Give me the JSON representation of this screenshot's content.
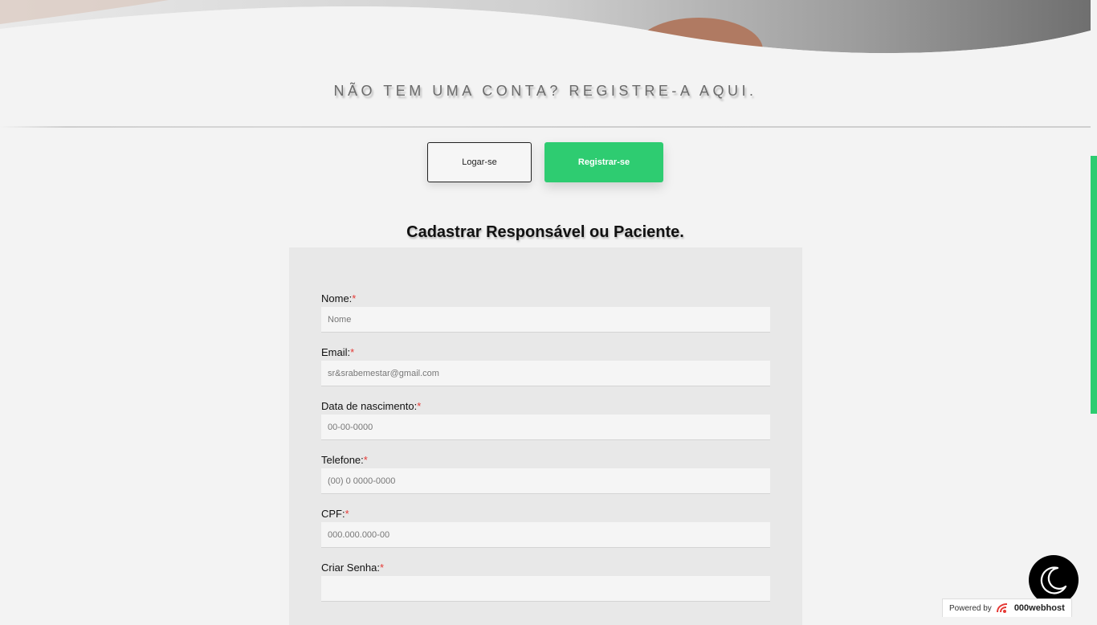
{
  "hero": {
    "image": "hero-photo"
  },
  "tagline": "NÃO TEM UMA CONTA? REGISTRE-A AQUI.",
  "actions": {
    "login_label": "Logar-se",
    "register_label": "Registrar-se"
  },
  "form": {
    "title": "Cadastrar Responsável ou Paciente.",
    "required_marker": "*",
    "fields": [
      {
        "label": "Nome:",
        "placeholder": "Nome",
        "value": ""
      },
      {
        "label": "Email:",
        "placeholder": "sr&srabemestar@gmail.com",
        "value": ""
      },
      {
        "label": "Data de nascimento:",
        "placeholder": "00-00-0000",
        "value": ""
      },
      {
        "label": "Telefone:",
        "placeholder": "(00) 0 0000-0000",
        "value": ""
      },
      {
        "label": "CPF:",
        "placeholder": "000.000.000-00",
        "value": ""
      },
      {
        "label": "Criar Senha:",
        "placeholder": "",
        "value": ""
      }
    ]
  },
  "theme_toggle": {
    "icon": "moon-icon"
  },
  "footer": {
    "powered_label": "Powered by",
    "brand": "000webhost",
    "icon": "000webhost-logo-icon"
  },
  "colors": {
    "accent": "#2ecc71",
    "background": "#f3f3f3",
    "card": "#e8e8e8",
    "required": "#e53935"
  }
}
